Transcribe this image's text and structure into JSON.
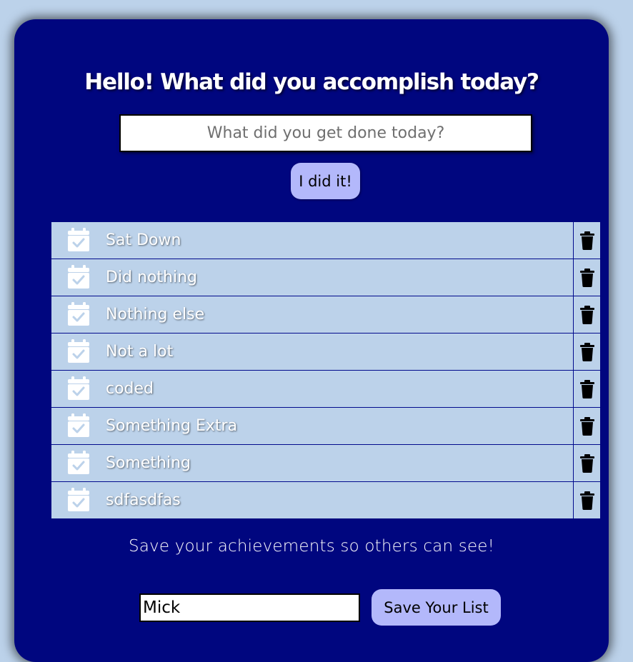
{
  "header": {
    "title": "Hello! What did you accomplish today?"
  },
  "task_input": {
    "placeholder": "What did you get done today?",
    "value": ""
  },
  "add_button": {
    "label": "I did it!"
  },
  "list": {
    "items": [
      {
        "label": "Sat Down",
        "icon": "calendar-check-icon",
        "delete_icon": "trash-icon"
      },
      {
        "label": "Did nothing",
        "icon": "calendar-check-icon",
        "delete_icon": "trash-icon"
      },
      {
        "label": "Nothing else",
        "icon": "calendar-check-icon",
        "delete_icon": "trash-icon"
      },
      {
        "label": "Not a lot",
        "icon": "calendar-check-icon",
        "delete_icon": "trash-icon"
      },
      {
        "label": "coded",
        "icon": "calendar-check-icon",
        "delete_icon": "trash-icon"
      },
      {
        "label": "Something Extra",
        "icon": "calendar-check-icon",
        "delete_icon": "trash-icon"
      },
      {
        "label": "Something",
        "icon": "calendar-check-icon",
        "delete_icon": "trash-icon"
      },
      {
        "label": "sdfasdfas",
        "icon": "calendar-check-icon",
        "delete_icon": "trash-icon"
      }
    ]
  },
  "save_section": {
    "message": "Save your achievements so others can see!",
    "name_value": "Mick",
    "button_label": "Save Your List"
  },
  "colors": {
    "page_background": "#bcd2ea",
    "card_background": "#00067f",
    "button_background": "#b3b8fb",
    "row_background": "#bcd2ea"
  }
}
